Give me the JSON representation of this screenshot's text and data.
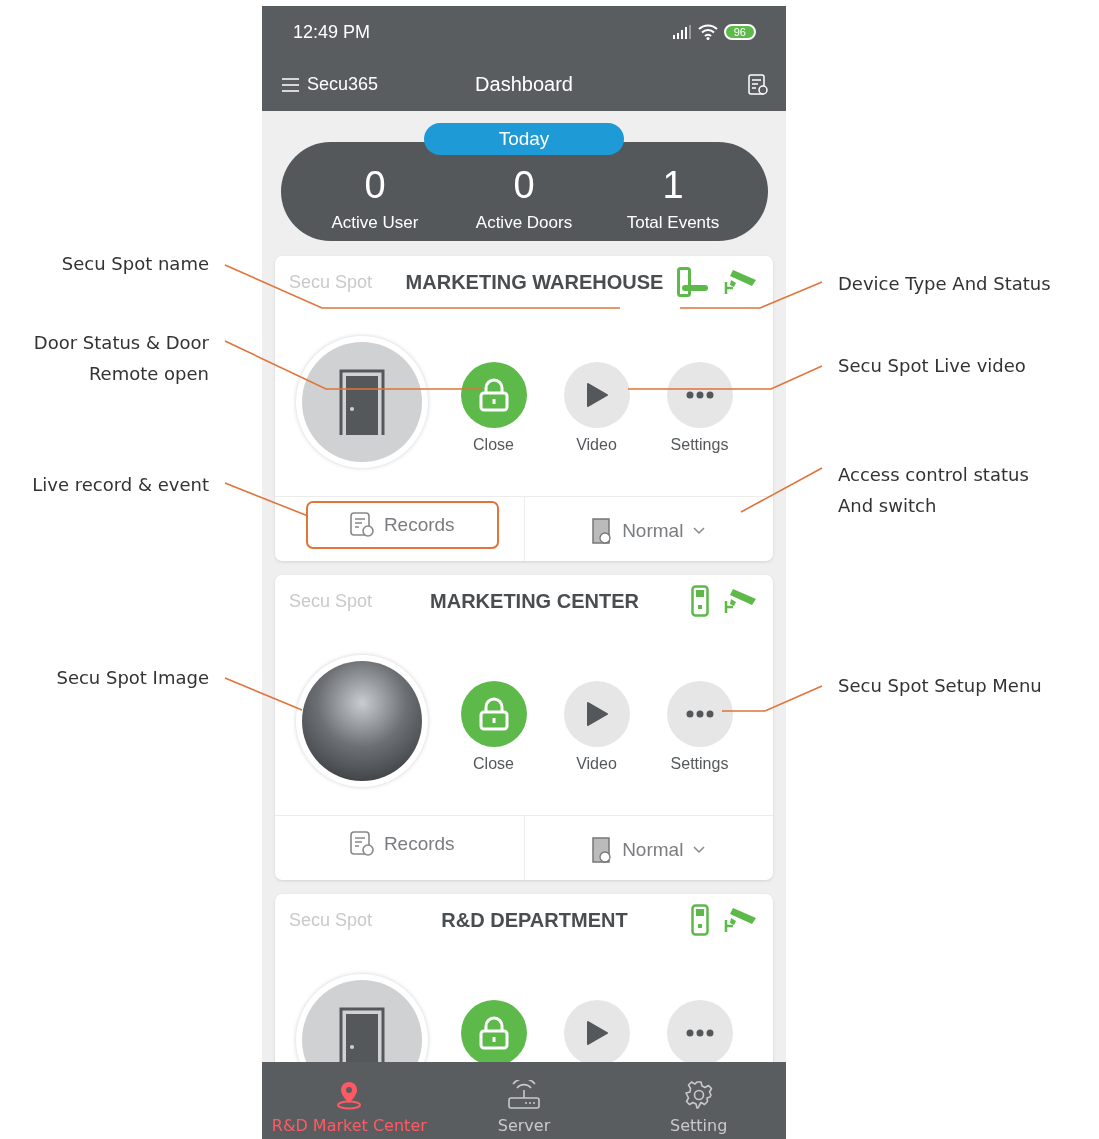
{
  "status_bar": {
    "time": "12:49 PM",
    "battery": "96"
  },
  "header": {
    "brand": "Secu365",
    "title": "Dashboard"
  },
  "summary": {
    "period": "Today",
    "stats": [
      {
        "value": "0",
        "label": "Active User"
      },
      {
        "value": "0",
        "label": "Active Doors"
      },
      {
        "value": "1",
        "label": "Total Events"
      }
    ]
  },
  "spots": [
    {
      "caption": "Secu Spot",
      "name": "MARKETING WAREHOUSE",
      "device": {
        "kind": "handle-lock"
      },
      "image": {
        "kind": "door"
      },
      "actions": [
        {
          "kind": "lock",
          "label": "Close"
        },
        {
          "kind": "play",
          "label": "Video"
        },
        {
          "kind": "more",
          "label": "Settings"
        }
      ],
      "records": "Records",
      "mode": "Normal",
      "records_highlighted": true
    },
    {
      "caption": "Secu Spot",
      "name": "MARKETING CENTER",
      "device": {
        "kind": "keypad"
      },
      "image": {
        "kind": "photo"
      },
      "actions": [
        {
          "kind": "lock",
          "label": "Close"
        },
        {
          "kind": "play",
          "label": "Video"
        },
        {
          "kind": "more",
          "label": "Settings"
        }
      ],
      "records": "Records",
      "mode": "Normal",
      "records_highlighted": false
    },
    {
      "caption": "Secu Spot",
      "name": "R&D DEPARTMENT",
      "device": {
        "kind": "keypad"
      },
      "image": {
        "kind": "door"
      },
      "actions": [
        {
          "kind": "lock"
        },
        {
          "kind": "play"
        },
        {
          "kind": "more"
        }
      ]
    }
  ],
  "nav": [
    {
      "label": "R&D Market Center",
      "kind": "pin",
      "selected": true
    },
    {
      "label": "Server",
      "kind": "router",
      "selected": false
    },
    {
      "label": "Setting",
      "kind": "gear",
      "selected": false
    }
  ],
  "annotations": [
    {
      "text": "Secu Spot name"
    },
    {
      "text": "Door Status & Door\nRemote open"
    },
    {
      "text": "Live record & event"
    },
    {
      "text": "Secu Spot Image"
    },
    {
      "text": "Device Type And Status"
    },
    {
      "text": "Secu Spot Live video"
    },
    {
      "text": "Access control status\nAnd switch"
    },
    {
      "text": "Secu Spot Setup Menu"
    }
  ]
}
